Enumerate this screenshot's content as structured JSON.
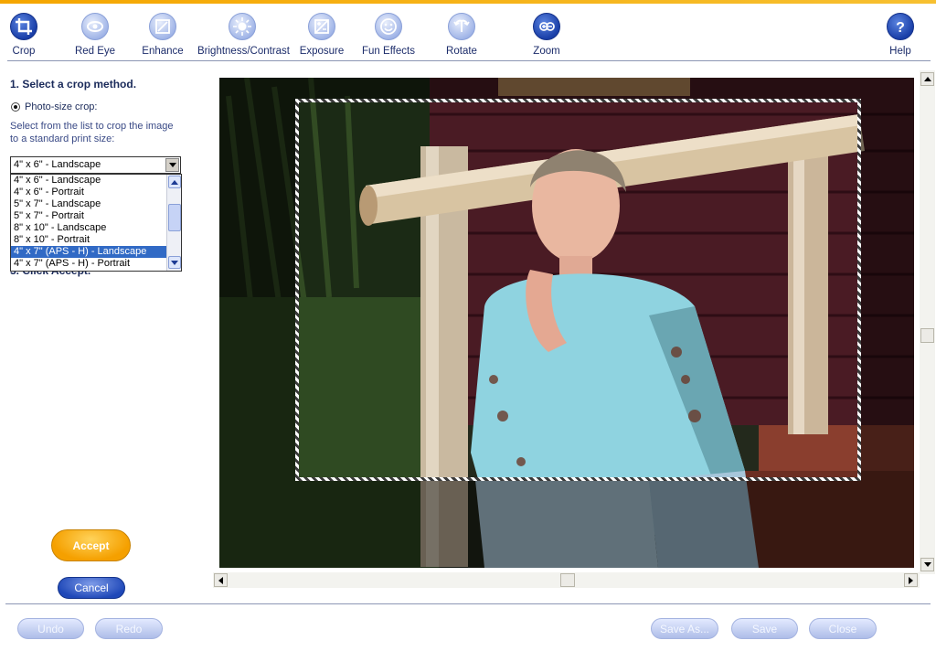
{
  "toolbar": {
    "tools": [
      {
        "label": "Crop",
        "icon": "crop-icon",
        "active": true
      },
      {
        "label": "Red Eye",
        "icon": "red-eye-icon"
      },
      {
        "label": "Enhance",
        "icon": "enhance-icon"
      },
      {
        "label": "Brightness/Contrast",
        "icon": "brightness-icon"
      },
      {
        "label": "Exposure",
        "icon": "exposure-icon"
      },
      {
        "label": "Fun Effects",
        "icon": "fun-effects-icon"
      },
      {
        "label": "Rotate",
        "icon": "rotate-icon"
      },
      {
        "label": "Zoom",
        "icon": "zoom-icon"
      },
      {
        "label": "Help",
        "icon": "help-icon"
      }
    ]
  },
  "panel": {
    "step1": "1. Select a crop method.",
    "radio_label": "Photo-size crop:",
    "help_text": "Select from the list to crop the image to a standard print size:",
    "step3": "3. Click Accept.",
    "selected_size": "4\" x 6\" - Landscape",
    "size_options": [
      "4\" x 6\" - Landscape",
      "4\" x 6\" - Portrait",
      "5\" x 7\" - Landscape",
      "5\" x 7\" - Portrait",
      "8\" x 10\" - Landscape",
      "8\" x 10\" - Portrait",
      "4\" x 7\" (APS - H) - Landscape",
      "4\" x 7\" (APS - H) - Portrait"
    ],
    "highlighted_option_index": 6,
    "accept_label": "Accept",
    "cancel_label": "Cancel"
  },
  "footer": {
    "undo_label": "Undo",
    "redo_label": "Redo",
    "save_as_label": "Save As...",
    "save_label": "Save",
    "close_label": "Close"
  },
  "colors": {
    "accent_orange": "#f5a600",
    "primary_blue": "#1a3fa8",
    "selection_blue": "#316ac5"
  }
}
